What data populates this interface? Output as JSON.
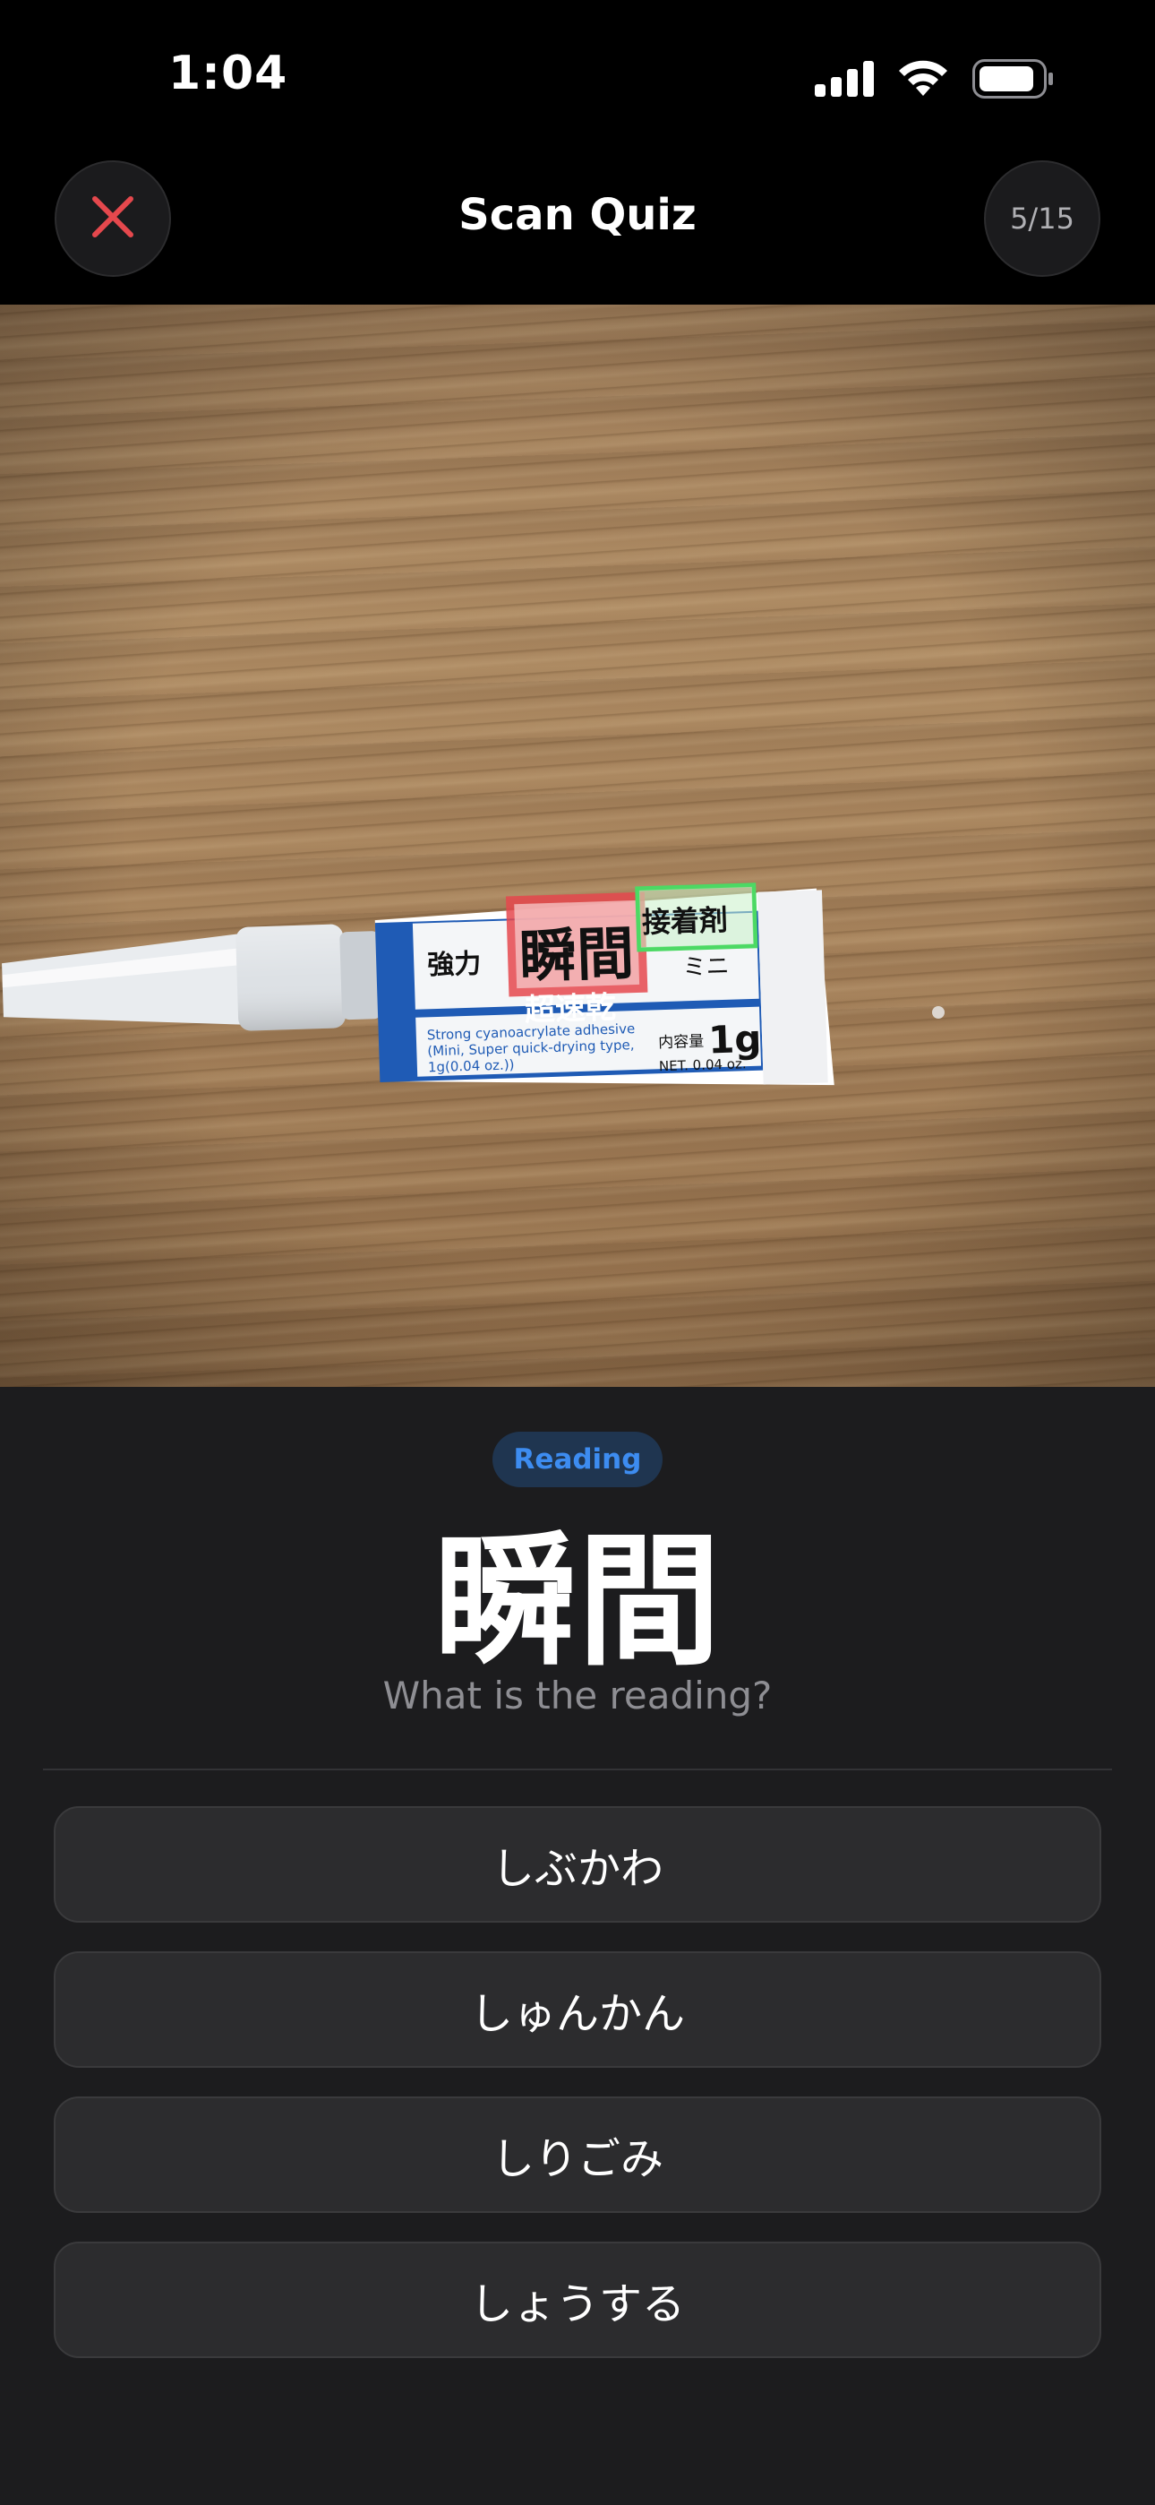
{
  "status_bar": {
    "time": "1:04",
    "icons": [
      "signal-icon",
      "wifi-icon",
      "battery-icon"
    ]
  },
  "nav": {
    "close_icon": "close-icon",
    "title": "Scan Quiz",
    "progress": "5/15",
    "close_color": "#e5484d"
  },
  "photo": {
    "label_texts": {
      "strength": "強力",
      "highlight_word": "瞬間",
      "adhesive": "接着剤",
      "mini": "ミニ",
      "quick_dry": "超速乾",
      "english_line1": "Strong cyanoacrylate adhesive",
      "english_line2": "(Mini, Super quick-drying type,",
      "english_line3": "1g(0.04 oz.))",
      "content_label": "内容量",
      "amount": "1g",
      "net": "NET.  0.04 oz."
    },
    "highlight_colors": {
      "target": "#e5484d",
      "other": "#4cd964"
    }
  },
  "quiz": {
    "type_badge": "Reading",
    "word": "瞬間",
    "prompt": "What is the reading?",
    "options": [
      "しぶかわ",
      "しゅんかん",
      "しりごみ",
      "しょうする"
    ]
  },
  "colors": {
    "background": "#000000",
    "panel": "#1c1c1e",
    "option_bg": "#2c2c2e",
    "badge_text": "#3d8cf0"
  }
}
